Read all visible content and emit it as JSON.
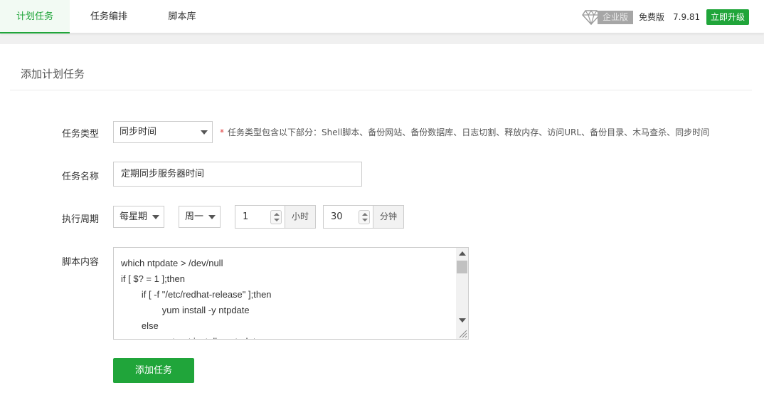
{
  "tabs": [
    {
      "label": "计划任务",
      "active": true
    },
    {
      "label": "任务编排",
      "active": false
    },
    {
      "label": "脚本库",
      "active": false
    }
  ],
  "header": {
    "gem_icon": "diamond-icon",
    "enterprise_label": "企业版",
    "free_label": "免费版",
    "version": "7.9.81",
    "upgrade_label": "立即升级"
  },
  "panel": {
    "title": "添加计划任务"
  },
  "form": {
    "task_type": {
      "label": "任务类型",
      "value": "同步时间",
      "hint_star": "*",
      "hint": "任务类型包含以下部分：Shell脚本、备份网站、备份数据库、日志切割、释放内存、访问URL、备份目录、木马查杀、同步时间"
    },
    "task_name": {
      "label": "任务名称",
      "value": "定期同步服务器时间"
    },
    "period": {
      "label": "执行周期",
      "cycle_value": "每星期",
      "weekday_value": "周一",
      "hour_value": "1",
      "hour_unit": "小时",
      "minute_value": "30",
      "minute_unit": "分钟"
    },
    "script": {
      "label": "脚本内容",
      "lines": [
        "which ntpdate > /dev/null",
        "if [ $? = 1 ];then",
        "        if [ -f \"/etc/redhat-release\" ];then",
        "                yum install -y ntpdate",
        "        else",
        "                apt-get install -y ntpdate"
      ]
    },
    "submit_label": "添加任务"
  },
  "colors": {
    "accent": "#20a53a",
    "required_star": "#e04040"
  }
}
